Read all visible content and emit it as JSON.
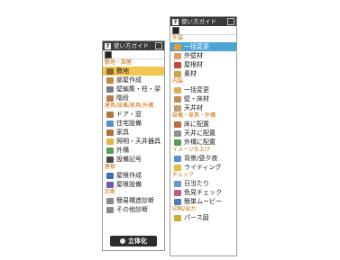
{
  "panel_left": {
    "title": "使い方ガイド",
    "sections": [
      {
        "label": "敷地・部屋",
        "items": [
          {
            "label": "敷地",
            "icon": "site-icon",
            "color": "#8a6b2a",
            "selected": true
          },
          {
            "label": "部屋作成",
            "icon": "room-icon",
            "color": "#c08a3e"
          },
          {
            "label": "壁編集・柱・梁",
            "icon": "wall-icon",
            "color": "#7d7d7d"
          },
          {
            "label": "階段",
            "icon": "stairs-icon",
            "color": "#b87d44"
          }
        ]
      },
      {
        "label": "建具/設備/家具/外構",
        "items": [
          {
            "label": "ドア・窓",
            "icon": "door-icon",
            "color": "#b07b3c"
          },
          {
            "label": "住宅設備",
            "icon": "equipment-icon",
            "color": "#5b8fc6"
          },
          {
            "label": "家具",
            "icon": "furniture-icon",
            "color": "#b0703c"
          },
          {
            "label": "照明・天井器具",
            "icon": "lighting-icon",
            "color": "#e2b73f"
          },
          {
            "label": "外構",
            "icon": "exterior-icon",
            "color": "#5a9a5a"
          },
          {
            "label": "設備記号",
            "icon": "symbol-icon",
            "color": "#4a4a4a"
          }
        ]
      },
      {
        "label": "屋根",
        "items": [
          {
            "label": "屋根作成",
            "icon": "roof-create-icon",
            "color": "#3c6fb3"
          },
          {
            "label": "屋根設備",
            "icon": "roof-equipment-icon",
            "color": "#6c5bb3"
          }
        ]
      },
      {
        "label": "診断",
        "items": [
          {
            "label": "簡易構造診断",
            "icon": "structure-icon",
            "color": "#8a8a8a"
          },
          {
            "label": "その他診断",
            "icon": "diagnosis-icon",
            "color": "#8a8a8a"
          }
        ]
      }
    ],
    "action_label": "立体化"
  },
  "panel_right": {
    "title": "使い方ガイド",
    "sections": [
      {
        "label": "外装",
        "items": [
          {
            "label": "一括変更",
            "icon": "bulk-change-icon",
            "color": "#e69a3a",
            "selected": true
          },
          {
            "label": "外壁材",
            "icon": "exterior-wall-icon",
            "color": "#e0a060"
          },
          {
            "label": "屋根材",
            "icon": "roof-material-icon",
            "color": "#c04a3a"
          },
          {
            "label": "素材",
            "icon": "material-icon",
            "color": "#d8a040"
          }
        ]
      },
      {
        "label": "内装",
        "items": [
          {
            "label": "一括変更",
            "icon": "bulk-change-icon",
            "color": "#e0b050"
          },
          {
            "label": "壁・床材",
            "icon": "wall-floor-icon",
            "color": "#c09050"
          },
          {
            "label": "天井材",
            "icon": "ceiling-icon",
            "color": "#c0a070"
          }
        ]
      },
      {
        "label": "設備・家具・外構",
        "items": [
          {
            "label": "床に配置",
            "icon": "floor-place-icon",
            "color": "#c06a3a"
          },
          {
            "label": "天井に配置",
            "icon": "ceiling-place-icon",
            "color": "#909090"
          },
          {
            "label": "外構に配置",
            "icon": "exterior-place-icon",
            "color": "#5a9a5a"
          }
        ]
      },
      {
        "label": "イメージ仕上げ",
        "items": [
          {
            "label": "背景/昼夕夜",
            "icon": "background-icon",
            "color": "#5a8fd0"
          },
          {
            "label": "ライティング",
            "icon": "lighting-setting-icon",
            "color": "#e2c040"
          }
        ]
      },
      {
        "label": "チェック",
        "items": [
          {
            "label": "日当たり",
            "icon": "sunlight-icon",
            "color": "#6a9ad0"
          },
          {
            "label": "色見チェック",
            "icon": "color-check-icon",
            "color": "#c05a8a"
          },
          {
            "label": "簡単ムービー",
            "icon": "movie-icon",
            "color": "#4a7ac0"
          }
        ]
      },
      {
        "label": "印刷/出力",
        "items": [
          {
            "label": "パース図",
            "icon": "perspective-icon",
            "color": "#c8b030"
          }
        ]
      }
    ]
  },
  "colors": {
    "accent_yellow": "#f3c64f",
    "accent_blue": "#4aa5d3",
    "category_orange": "#c86a00",
    "titlebar": "#3a3a3a"
  }
}
